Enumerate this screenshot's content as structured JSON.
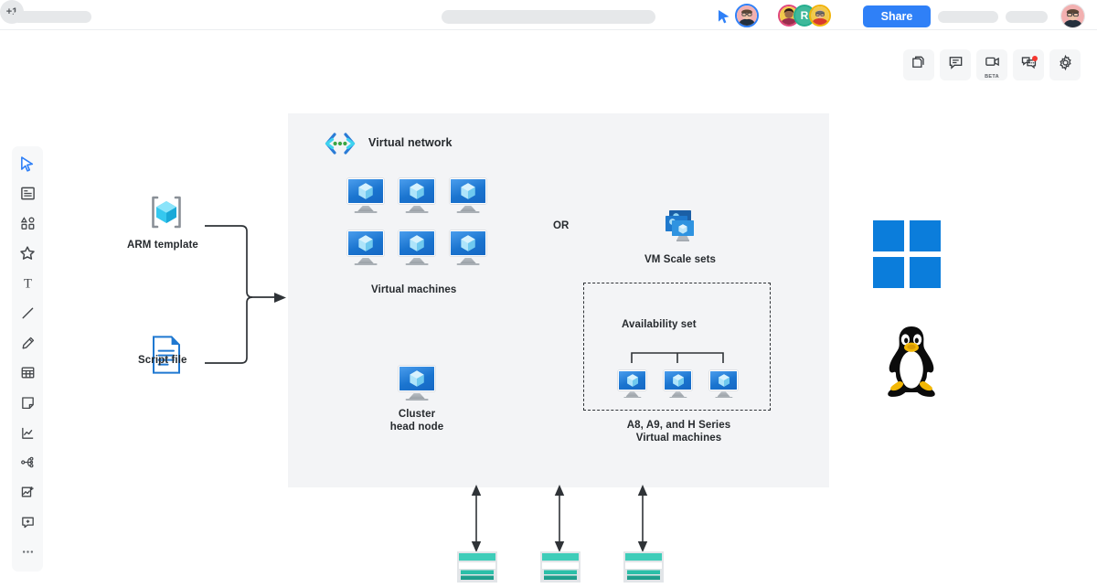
{
  "topbar": {
    "share_label": "Share",
    "overflow_count": "+1",
    "avatar_initial": "R",
    "cursor_icon": "presence-cursor-icon"
  },
  "toolstrip": {
    "buttons": [
      {
        "name": "pages-icon",
        "label": ""
      },
      {
        "name": "comment-icon",
        "label": ""
      },
      {
        "name": "video-camera-icon",
        "label": "BETA"
      },
      {
        "name": "chat-icon",
        "label": ""
      },
      {
        "name": "gear-icon",
        "label": ""
      }
    ]
  },
  "sidebar": {
    "items": [
      {
        "name": "cursor-select-tool",
        "icon": "cursor-icon"
      },
      {
        "name": "frame-tool",
        "icon": "frame-icon"
      },
      {
        "name": "shapes-tool",
        "icon": "shapes-icon"
      },
      {
        "name": "sticker-tool",
        "icon": "star-icon"
      },
      {
        "name": "text-tool",
        "icon": "text-t-icon"
      },
      {
        "name": "line-tool",
        "icon": "line-icon"
      },
      {
        "name": "pen-tool",
        "icon": "pen-icon"
      },
      {
        "name": "table-tool",
        "icon": "table-icon"
      },
      {
        "name": "note-tool",
        "icon": "sticky-note-icon"
      },
      {
        "name": "chart-tool",
        "icon": "line-chart-icon"
      },
      {
        "name": "mindmap-tool",
        "icon": "mindmap-icon"
      },
      {
        "name": "image-tool",
        "icon": "image-plus-icon"
      },
      {
        "name": "comment-add-tool",
        "icon": "comment-plus-icon"
      },
      {
        "name": "more-tools",
        "icon": "ellipsis-icon"
      }
    ]
  },
  "diagram": {
    "virtual_network_label": "Virtual network",
    "virtual_machines_label": "Virtual machines",
    "or_label": "OR",
    "vm_scale_sets_label": "VM Scale sets",
    "cluster_head_node_label": "Cluster\nhead node",
    "availability_set_label": "Availability set",
    "availability_vms_label": "A8, A9, and H Series\nVirtual machines",
    "arm_template_label": "ARM template",
    "script_file_label": "Script file",
    "vm_grid_count": 6,
    "availability_vm_count": 3,
    "storage_node_count": 3,
    "os_logos": [
      "windows-logo",
      "linux-penguin-logo"
    ],
    "colors": {
      "panel_background": "#f3f4f6",
      "vm_blue": "#1a74cf",
      "cube_cyan": "#5fd6f5",
      "accent_blue": "#2f80f7",
      "storage_teal": "#2bbfa8",
      "windows_blue": "#0b7ddb",
      "connector_dark": "#2f3337"
    }
  }
}
